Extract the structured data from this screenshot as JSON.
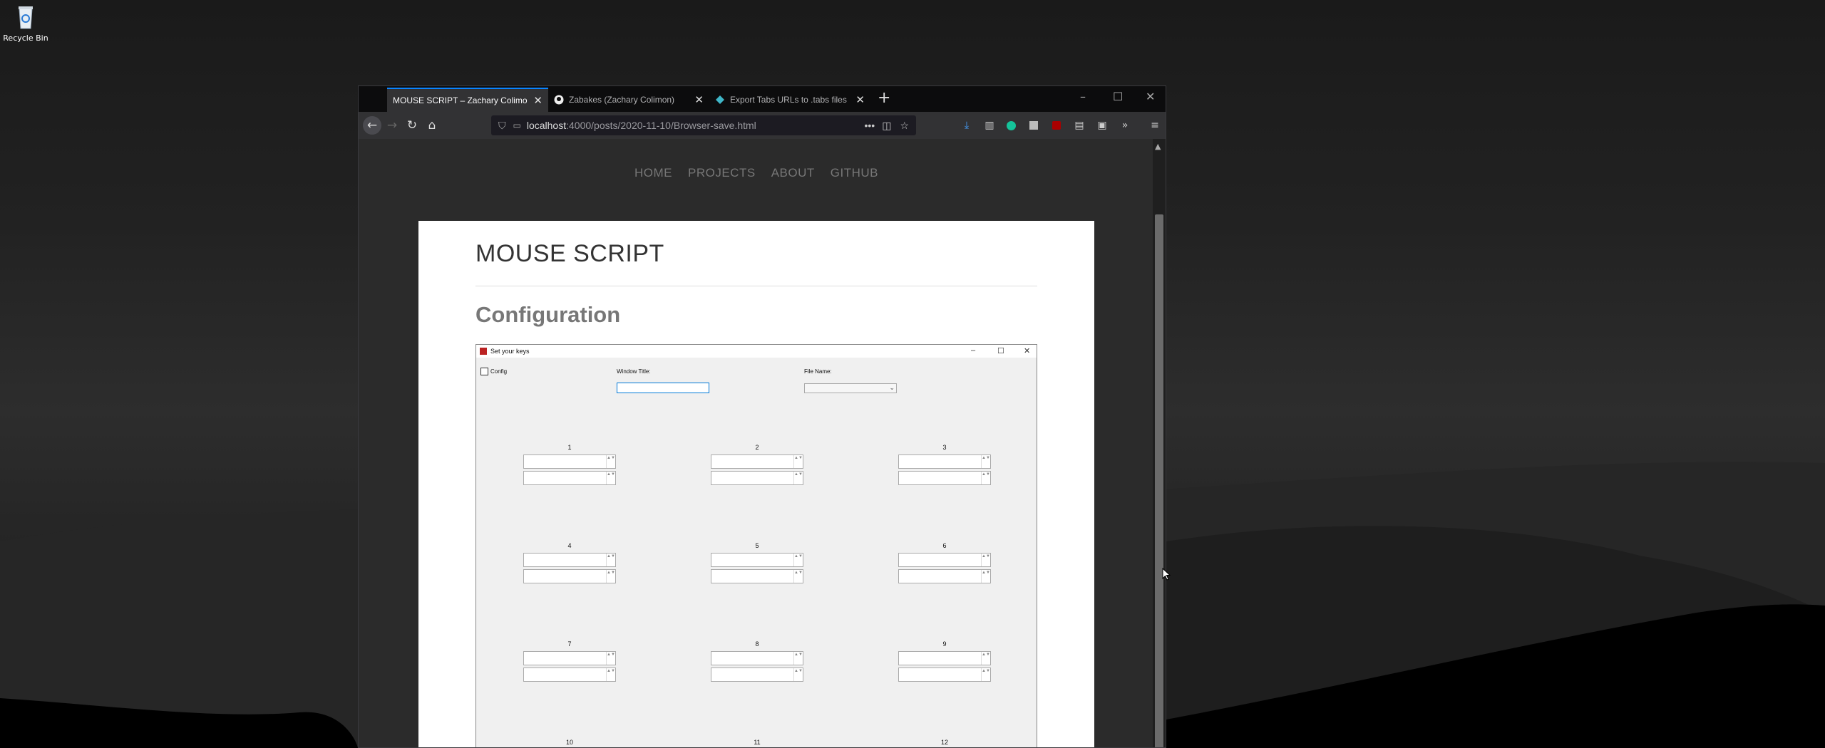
{
  "desktop": {
    "recycle_bin_label": "Recycle Bin"
  },
  "browser": {
    "tabs": [
      {
        "title": "MOUSE SCRIPT – Zachary Colimon",
        "active": true
      },
      {
        "title": "Zabakes (Zachary Colimon)",
        "active": false
      },
      {
        "title": "Export Tabs URLs to .tabs files",
        "active": false
      }
    ],
    "url": {
      "host": "localhost",
      "path": ":4000/posts/2020-11-10/Browser-save.html"
    },
    "page_menu_label": "•••"
  },
  "page": {
    "nav": [
      "HOME",
      "PROJECTS",
      "ABOUT",
      "GITHUB"
    ],
    "title": "MOUSE SCRIPT",
    "section_heading": "Configuration"
  },
  "form_window": {
    "title": "Set your keys",
    "config_label": "Config",
    "window_title_label": "Window Title:",
    "file_name_label": "File Name:",
    "slots": [
      "1",
      "2",
      "3",
      "4",
      "5",
      "6",
      "7",
      "8",
      "9",
      "10",
      "11",
      "12"
    ]
  },
  "colors": {
    "tab_accent": "#0a84ff",
    "article_bg": "#ffffff",
    "heading_gray": "#777777"
  }
}
